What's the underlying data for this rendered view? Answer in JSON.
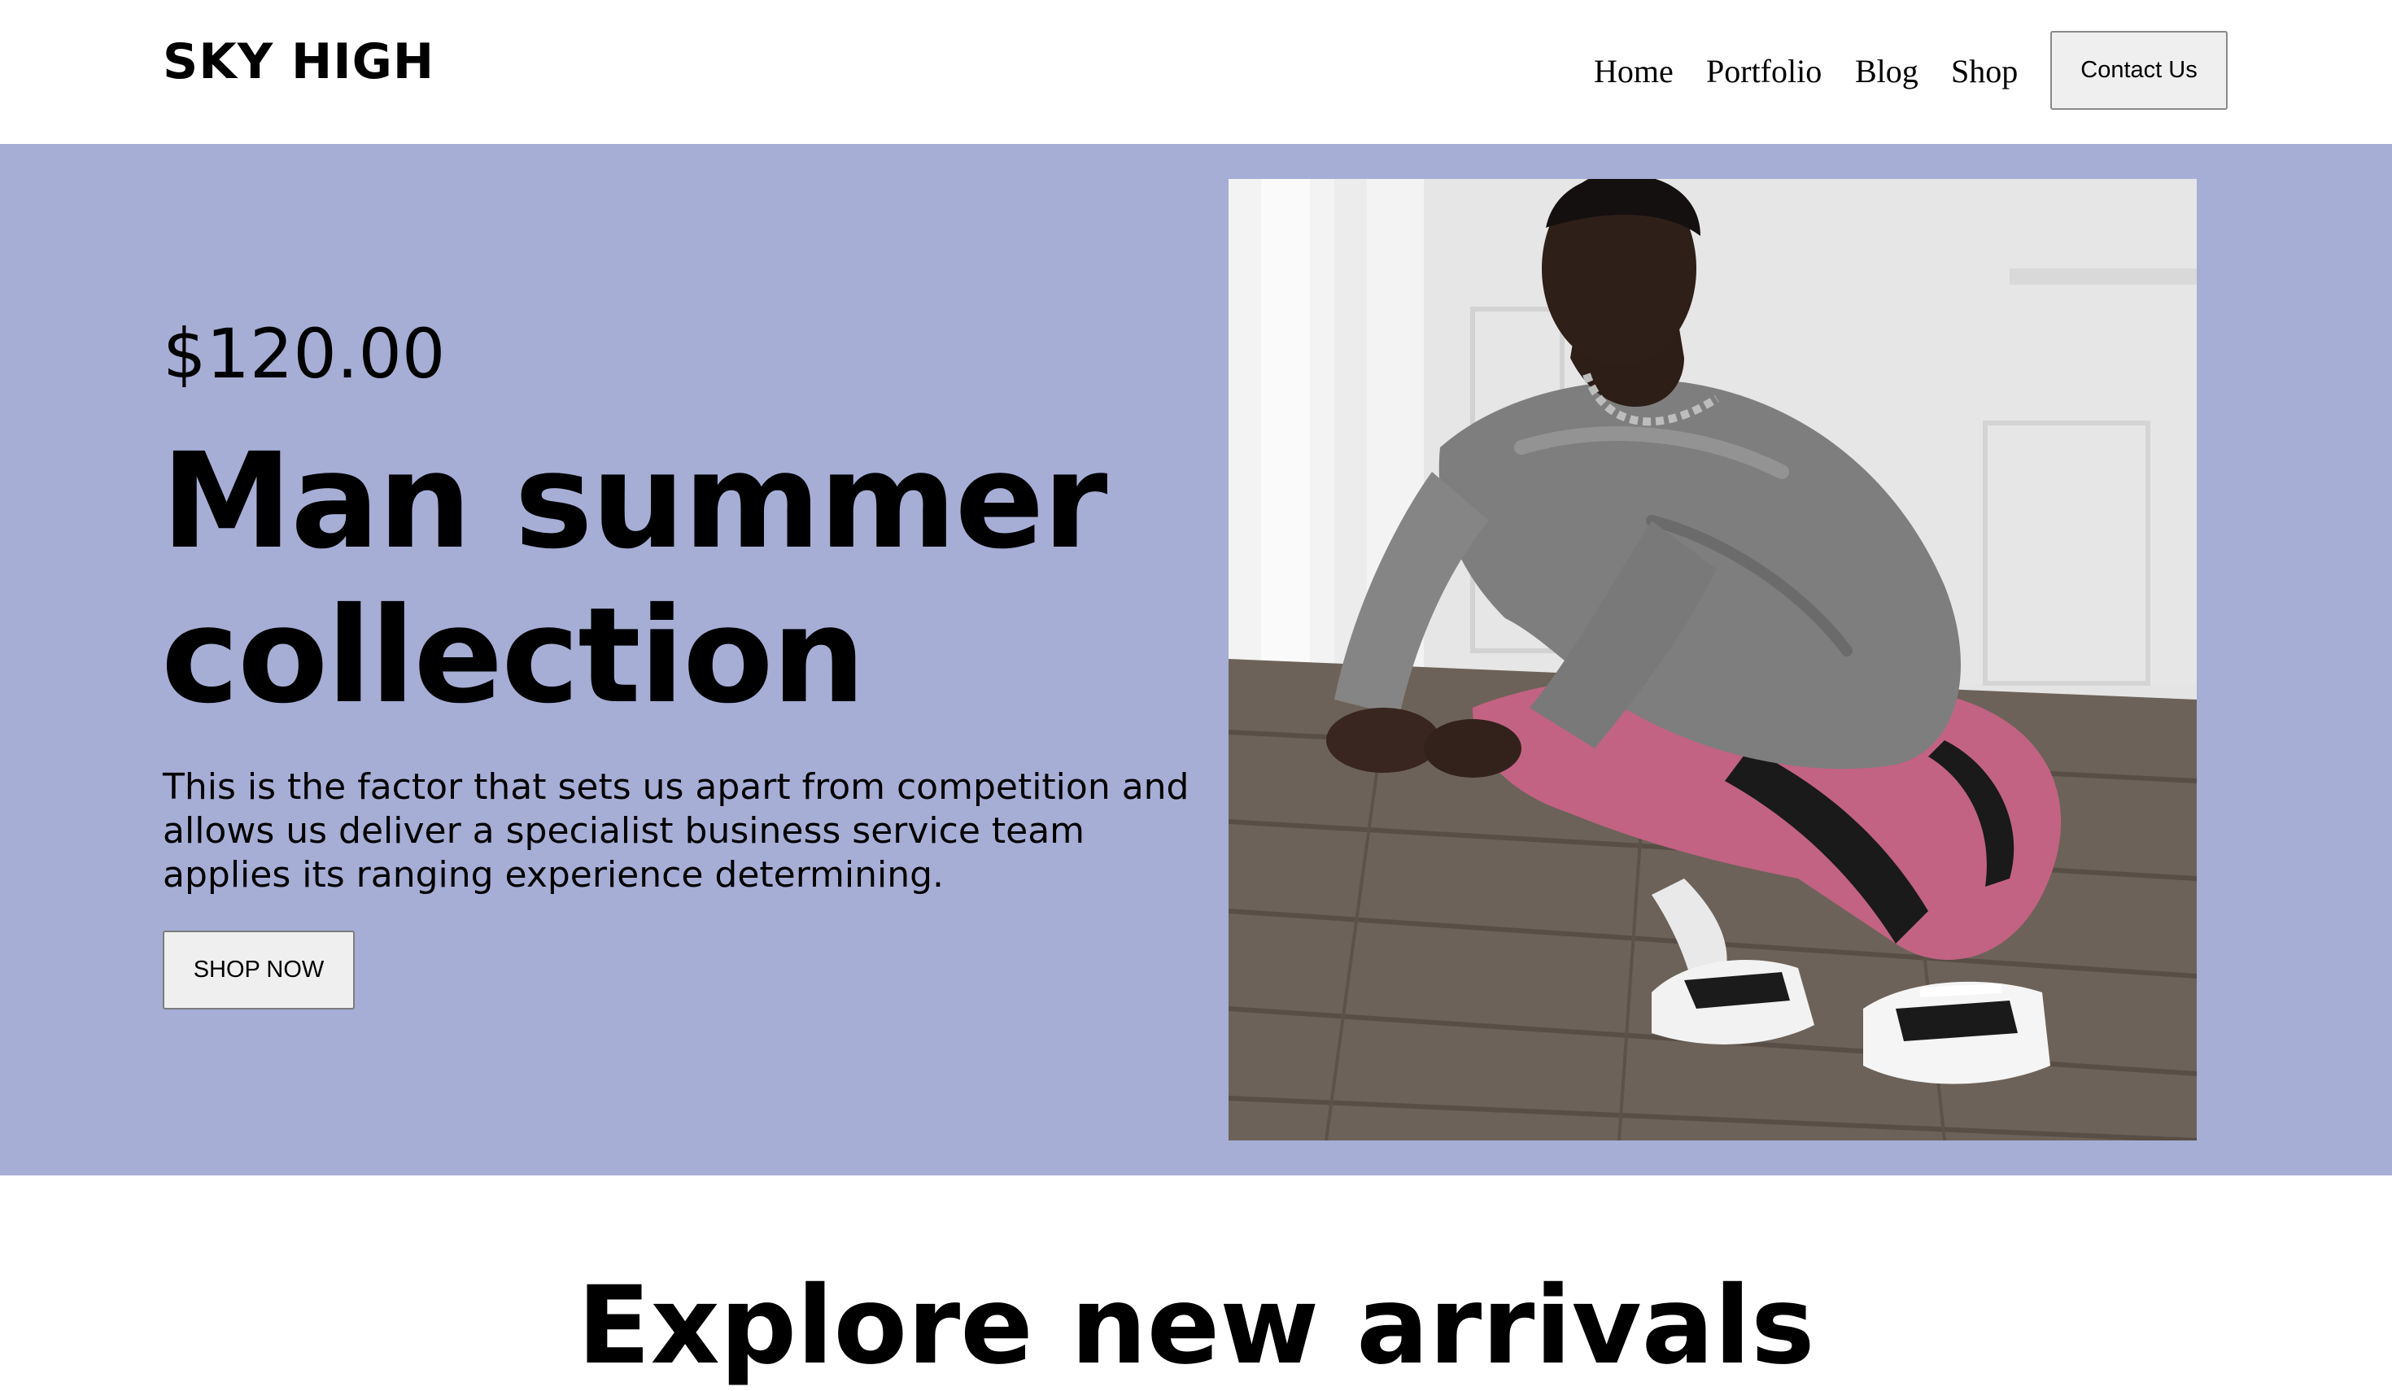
{
  "header": {
    "brand": "SKY HIGH",
    "nav": [
      {
        "label": "Home"
      },
      {
        "label": "Portfolio"
      },
      {
        "label": "Blog"
      },
      {
        "label": "Shop"
      }
    ],
    "contact_label": "Contact Us"
  },
  "hero": {
    "price": "$120.00",
    "title": "Man summer collection",
    "description": "This is the factor that sets us apart from competition and allows us deliver a specialist business service team applies its ranging experience determining.",
    "shop_label": "SHOP NOW",
    "background_color": "#a6aed6"
  },
  "section": {
    "title": "Explore new arrivals"
  }
}
